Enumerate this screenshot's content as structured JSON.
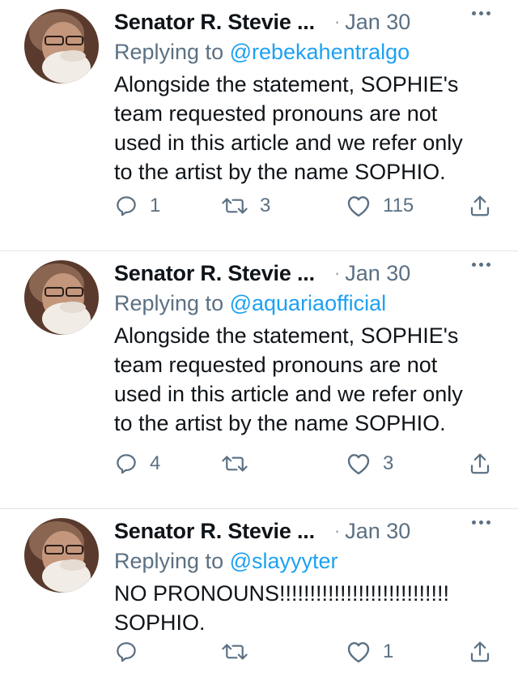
{
  "tweets": [
    {
      "author": "Senator R. Stevie ...",
      "separator": "·",
      "date": "Jan 30",
      "replying_prefix": "Replying to ",
      "replying_to": "@rebekahentralgo",
      "text": "Alongside the statement, SOPHIE's\nteam requested pronouns are not\nused in this article and we refer only\nto the artist by the name SOPHIO.",
      "replies": "1",
      "retweets": "3",
      "likes": "115"
    },
    {
      "author": "Senator R. Stevie ...",
      "separator": "·",
      "date": "Jan 30",
      "replying_prefix": "Replying to ",
      "replying_to": "@aquariaofficial",
      "text": "Alongside the statement, SOPHIE's\nteam requested pronouns are not\nused in this article and we refer only\nto the artist by the name SOPHIO.",
      "replies": "4",
      "retweets": "",
      "likes": "3"
    },
    {
      "author": "Senator R. Stevie ...",
      "separator": "·",
      "date": "Jan 30",
      "replying_prefix": "Replying to ",
      "replying_to": "@slayyyter",
      "text": "NO PRONOUNS!!!!!!!!!!!!!!!!!!!!!!!!!!!!\nSOPHIO.",
      "replies": "",
      "retweets": "",
      "likes": "1"
    }
  ],
  "icons": {
    "reply": "reply-icon",
    "retweet": "retweet-icon",
    "like": "like-icon",
    "share": "share-icon",
    "more": "more-icon"
  },
  "colors": {
    "handle": "#1da1f2",
    "secondary_text": "#5b7083",
    "divider": "#e1e5e8"
  }
}
